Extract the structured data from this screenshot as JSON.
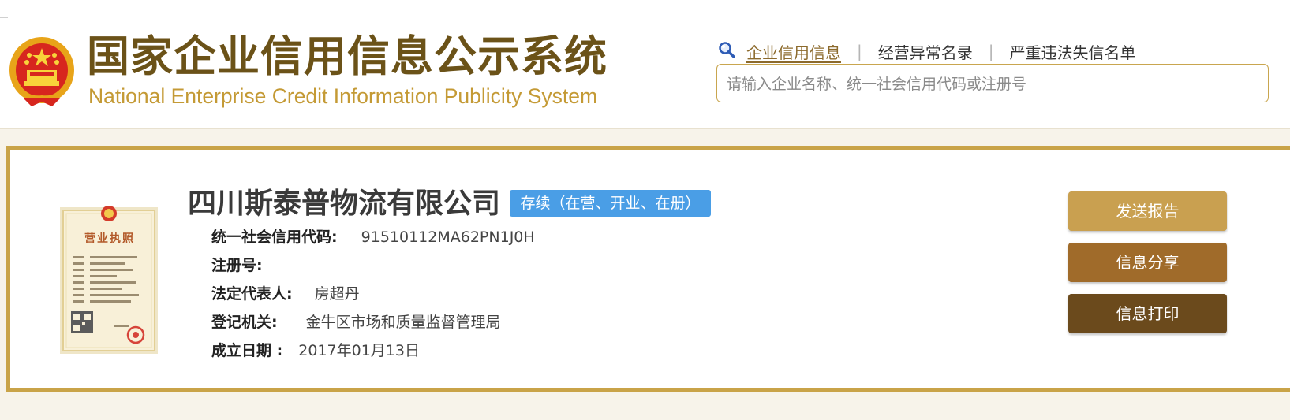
{
  "header": {
    "title_zh": "国家企业信用信息公示系统",
    "title_en": "National Enterprise Credit Information Publicity System",
    "nav": [
      {
        "label": "企业信用信息",
        "active": true
      },
      {
        "label": "经营异常名录",
        "active": false
      },
      {
        "label": "严重违法失信名单",
        "active": false
      }
    ],
    "nav_separator": "|",
    "search": {
      "placeholder": "请输入企业名称、统一社会信用代码或注册号",
      "value": ""
    }
  },
  "company": {
    "name": "四川斯泰普物流有限公司",
    "status": "存续（在营、开业、在册）",
    "license_image": {
      "title": "营业执照",
      "icon": "business-license-thumbnail"
    },
    "fields": [
      {
        "label": "统一社会信用代码:",
        "value": "91510112MA62PN1J0H"
      },
      {
        "label": "注册号:",
        "value": ""
      },
      {
        "label": "法定代表人:",
        "value": "房超丹"
      },
      {
        "label": "登记机关:",
        "value": "金牛区市场和质量监督管理局"
      },
      {
        "label": "成立日期 :",
        "value": "2017年01月13日"
      }
    ]
  },
  "actions": [
    {
      "label": "发送报告",
      "color": "#c9a050"
    },
    {
      "label": "信息分享",
      "color": "#a06b2a"
    },
    {
      "label": "信息打印",
      "color": "#6b4a1c"
    }
  ],
  "colors": {
    "brand_brown": "#6b5218",
    "brand_gold": "#c49a35",
    "card_border": "#c9a348",
    "status_blue": "#4a9ee6"
  }
}
